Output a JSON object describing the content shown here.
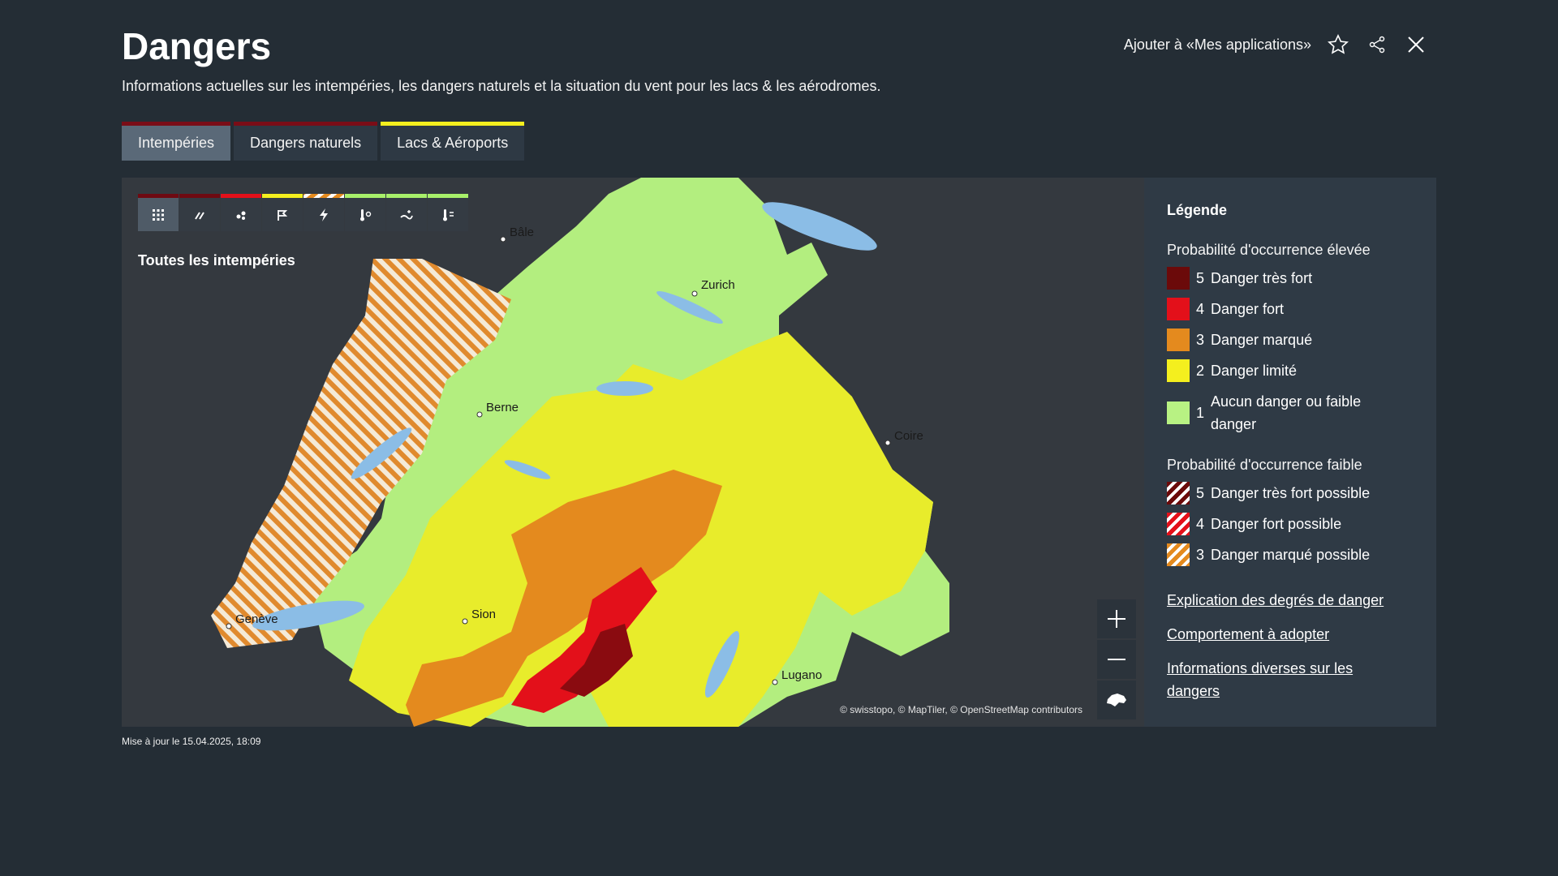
{
  "header": {
    "title": "Dangers",
    "subtitle": "Informations actuelles sur les intempéries, les dangers naturels et la situation du vent pour les lacs & les aérodromes.",
    "add_app_label": "Ajouter à «Mes applications»",
    "icons": [
      "star-icon",
      "share-icon",
      "close-icon"
    ]
  },
  "tabs": [
    {
      "label": "Intempéries",
      "active": true,
      "accent": "#7a0d17"
    },
    {
      "label": "Dangers naturels",
      "active": false,
      "accent": "#7a0d17"
    },
    {
      "label": "Lacs & Aéroports",
      "active": false,
      "accent": "#f4ef1e"
    }
  ],
  "map": {
    "label": "Toutes les intempéries",
    "filters": [
      {
        "icon": "grid-icon",
        "accent": "#6e0a12",
        "active": true
      },
      {
        "icon": "rain-icon",
        "accent": "#6e0a12"
      },
      {
        "icon": "snow-icon",
        "accent": "#e3101a"
      },
      {
        "icon": "wind-icon",
        "accent": "#f4ef1e"
      },
      {
        "icon": "lightning-icon",
        "accent": "hatched-orange"
      },
      {
        "icon": "heat-icon",
        "accent": "#a8f06a"
      },
      {
        "icon": "frost-icon",
        "accent": "#a8f06a"
      },
      {
        "icon": "cold-icon",
        "accent": "#a8f06a"
      }
    ],
    "cities": [
      "Bâle",
      "Zurich",
      "Berne",
      "Coire",
      "Sion",
      "Genève",
      "Lugano"
    ],
    "attribution": "© swisstopo, © MapTiler, © OpenStreetMap contributors",
    "zoom_icons": [
      "plus-icon",
      "minus-icon",
      "switzerland-icon"
    ]
  },
  "legend": {
    "title": "Légende",
    "high_title": "Probabilité d'occurrence élevée",
    "high_items": [
      {
        "num": "5",
        "label": "Danger très fort",
        "color": "#6b0a0a"
      },
      {
        "num": "4",
        "label": "Danger fort",
        "color": "#e3101a"
      },
      {
        "num": "3",
        "label": "Danger marqué",
        "color": "#e48a1e"
      },
      {
        "num": "2",
        "label": "Danger limité",
        "color": "#f4ef1e"
      },
      {
        "num": "1",
        "label": "Aucun danger ou faible danger",
        "color": "#b8f283"
      }
    ],
    "low_title": "Probabilité d'occurrence faible",
    "low_items": [
      {
        "num": "5",
        "label": "Danger très fort possible"
      },
      {
        "num": "4",
        "label": "Danger fort possible"
      },
      {
        "num": "3",
        "label": "Danger marqué possible"
      }
    ],
    "links": [
      "Explication des degrés de danger",
      "Comportement à adopter",
      "Informations diverses sur les dangers"
    ]
  },
  "updated": "Mise à jour le 15.04.2025, 18:09"
}
